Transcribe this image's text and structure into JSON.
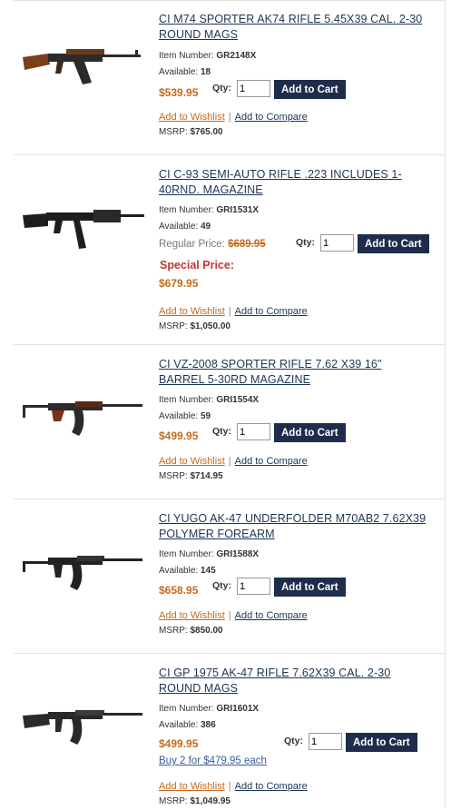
{
  "labels": {
    "item_number": "Item Number:",
    "available": "Available:",
    "qty": "Qty:",
    "add_to_cart": "Add to Cart",
    "add_to_wishlist": "Add to Wishlist",
    "add_to_compare": "Add to Compare",
    "separator": "|",
    "msrp": "MSRP:",
    "regular_price": "Regular Price:",
    "special_price": "Special Price:"
  },
  "products": [
    {
      "title_line1": "CI M74 SPORTER AK74 RIFLE 5.45X39 CAL. 2-30",
      "title_line2": "ROUND MAGS",
      "item_number": "GR2148X",
      "available": "18",
      "price": "$539.95",
      "qty": "1",
      "msrp": "$765.00",
      "image_icon": "ak74-rifle-wood-stock"
    },
    {
      "title_line1": "CI C-93 SEMI-AUTO RIFLE .223 INCLUDES 1-",
      "title_line2": "40RND. MAGAZINE",
      "item_number": "GRI1531X",
      "available": "49",
      "regular_price": "$689.95",
      "special_price": "$679.95",
      "qty": "1",
      "msrp": "$1,050.00",
      "image_icon": "c93-rifle-black"
    },
    {
      "title_line1": "CI VZ-2008 SPORTER RIFLE 7.62 X39 16\"",
      "title_line2": "BARREL 5-30RD MAGAZINE",
      "item_number": "GRI1554X",
      "available": "59",
      "price": "$499.95",
      "qty": "1",
      "msrp": "$714.95",
      "image_icon": "vz2008-rifle-folding-stock"
    },
    {
      "title_line1": "CI YUGO AK-47 UNDERFOLDER M70AB2 7.62X39",
      "title_line2": "POLYMER FOREARM",
      "item_number": "GRI1588X",
      "available": "145",
      "price": "$658.95",
      "qty": "1",
      "msrp": "$850.00",
      "image_icon": "yugo-ak47-underfolder"
    },
    {
      "title_line1": "CI GP 1975 AK-47 RIFLE 7.62X39 CAL. 2-30",
      "title_line2": "ROUND MAGS",
      "item_number": "GRI1601X",
      "available": "386",
      "price": "$499.95",
      "tier_price": "Buy 2 for $479.95 each",
      "qty": "1",
      "msrp": "$1,049.95",
      "image_icon": "gp1975-ak47-rifle"
    }
  ]
}
